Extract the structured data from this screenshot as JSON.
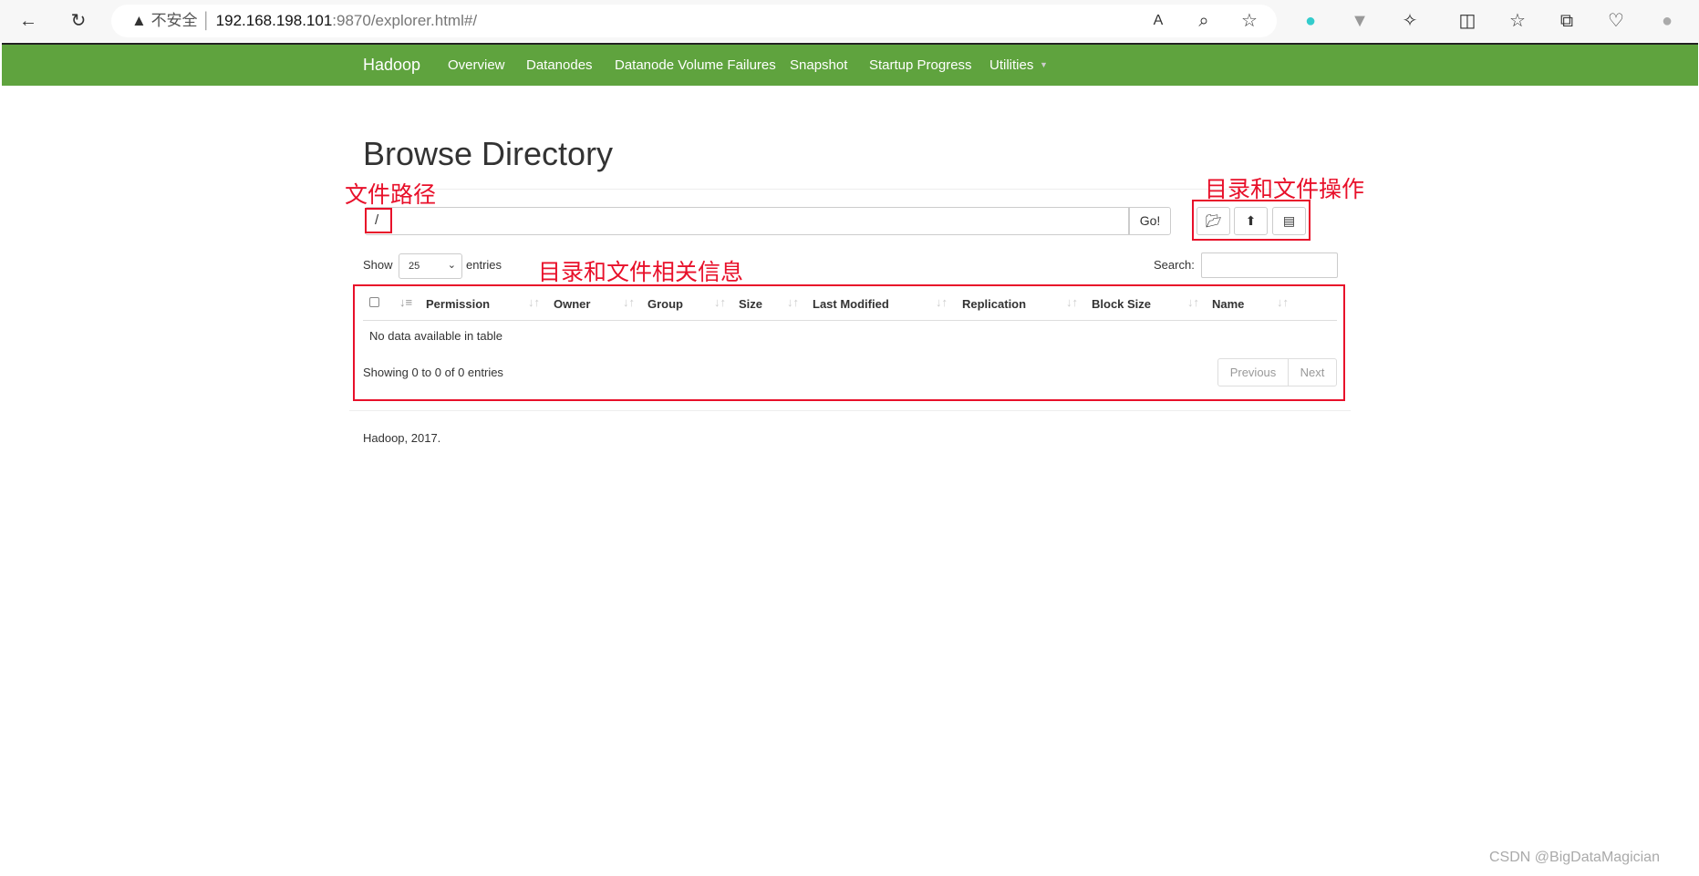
{
  "browser": {
    "security": "不安全",
    "url_host": "192.168.198.101",
    "url_rest": ":9870/explorer.html#/"
  },
  "nav": {
    "brand": "Hadoop",
    "items": [
      "Overview",
      "Datanodes",
      "Datanode Volume Failures",
      "Snapshot",
      "Startup Progress",
      "Utilities"
    ]
  },
  "page": {
    "title": "Browse Directory",
    "path_value": "/",
    "go_label": "Go!",
    "show_label": "Show",
    "entries_label": "entries",
    "page_size": "25",
    "search_label": "Search:",
    "columns": [
      "Permission",
      "Owner",
      "Group",
      "Size",
      "Last Modified",
      "Replication",
      "Block Size",
      "Name"
    ],
    "empty": "No data available in table",
    "info": "Showing 0 to 0 of 0 entries",
    "prev": "Previous",
    "next": "Next",
    "footer": "Hadoop, 2017."
  },
  "annotations": {
    "path": "文件路径",
    "ops": "目录和文件操作",
    "info": "目录和文件相关信息"
  },
  "watermark": "CSDN @BigDataMagician"
}
